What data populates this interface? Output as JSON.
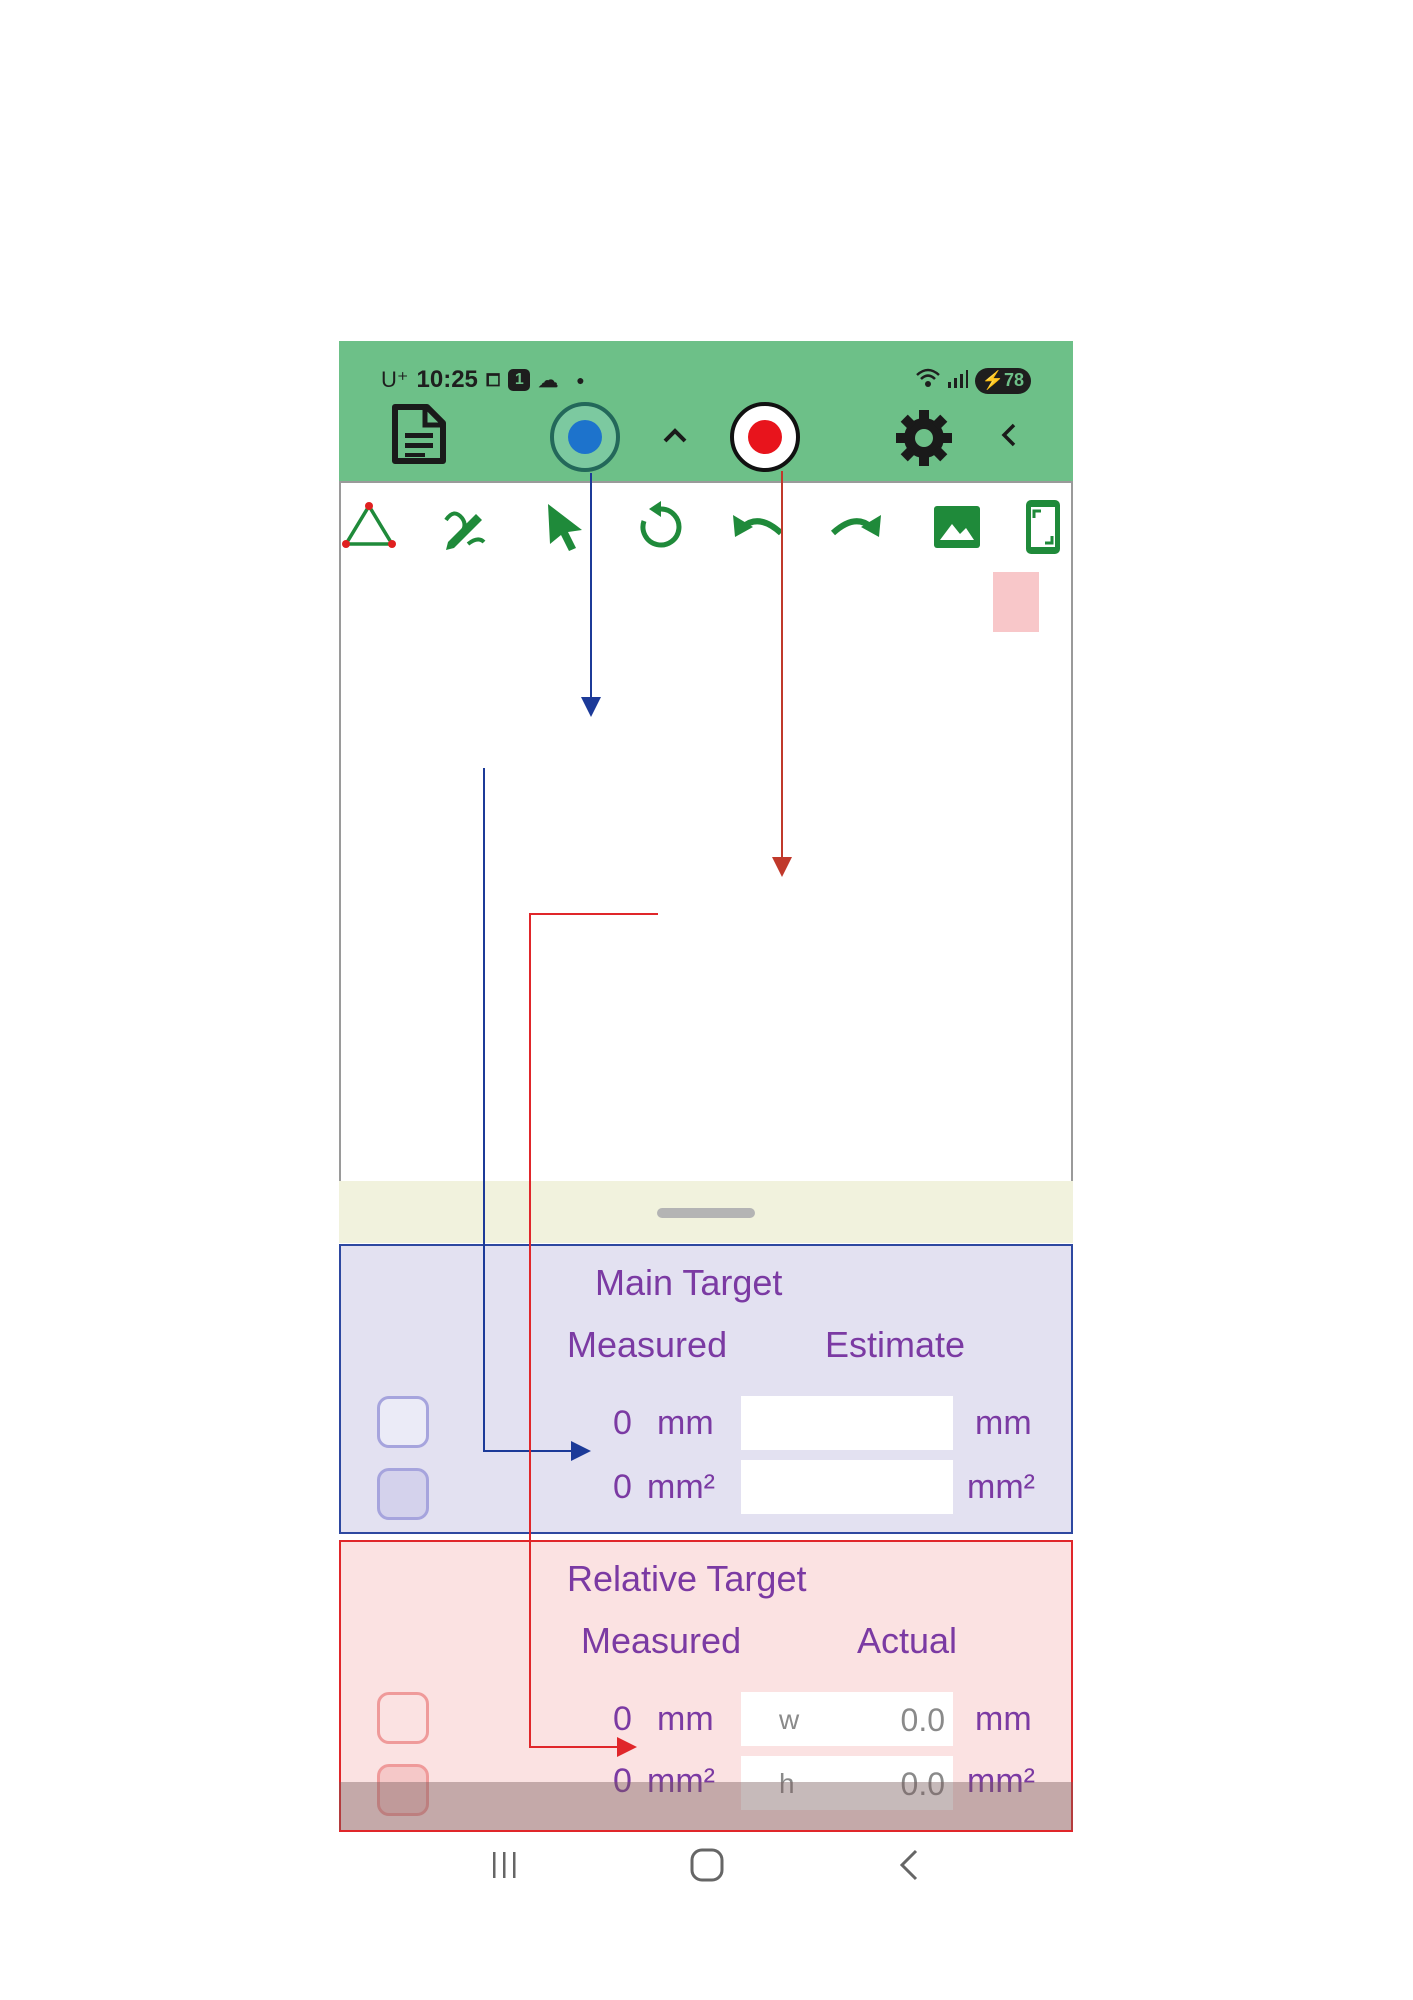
{
  "status_bar": {
    "carrier": "U⁺",
    "time": "10:25",
    "notification_count": "1",
    "battery": "78"
  },
  "appbar_icons": [
    "document-icon",
    "record-blue-icon",
    "chevron-up-icon",
    "record-red-icon",
    "settings-icon",
    "back-icon"
  ],
  "tools": [
    "triangle-tool-icon",
    "draw-tool-icon",
    "select-tool-icon",
    "rotate-tool-icon",
    "undo-icon",
    "redo-icon",
    "image-icon",
    "screen-icon"
  ],
  "colors": {
    "appbar": "#6dc088",
    "main_panel_bg": "#e3e1f1",
    "main_panel_border": "#2e48a0",
    "relative_panel_bg": "#fbe2e2",
    "relative_panel_border": "#e0262a",
    "text_purple": "#7b3aa3"
  },
  "main_target": {
    "title": "Main Target",
    "measured_header": "Measured",
    "estimate_header": "Estimate",
    "length_value": "0",
    "length_unit": "mm",
    "length_estimate_unit": "mm",
    "area_value": "0",
    "area_unit": "mm²",
    "area_estimate_unit": "mm²"
  },
  "relative_target": {
    "title": "Relative Target",
    "measured_header": "Measured",
    "actual_header": "Actual",
    "length_value": "0",
    "length_unit": "mm",
    "w_placeholder": "w",
    "w_value": "0.0",
    "w_unit": "mm",
    "area_value": "0",
    "area_unit": "mm²",
    "h_placeholder": "h",
    "h_value": "0.0",
    "h_unit": "mm²"
  }
}
